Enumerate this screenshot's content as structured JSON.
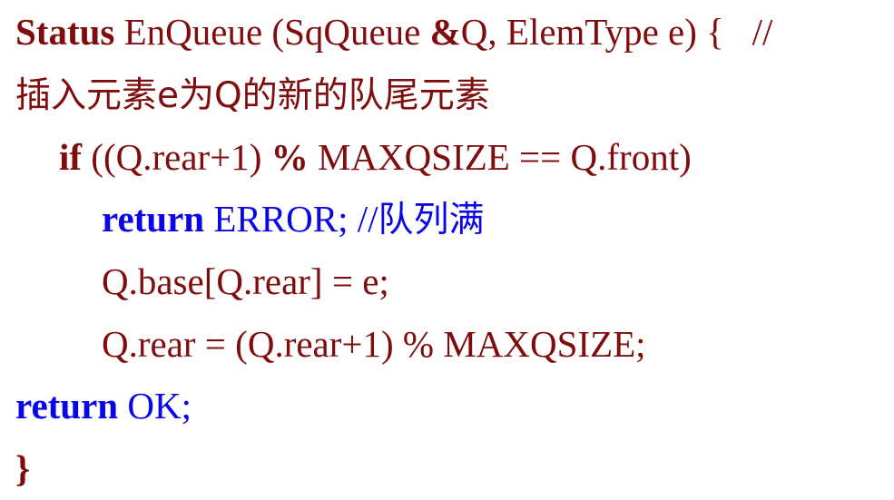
{
  "code": {
    "line1": {
      "keyword": "Status",
      "rest_before_amp": " EnQueue (SqQueue ",
      "amp": "&",
      "rest_after_amp": "Q, ElemType e) {   //"
    },
    "line2": {
      "comment_text": "插入元素e为Q的新的队尾元素"
    },
    "line3": {
      "keyword_if": "if",
      "part1": " ((Q.rear+1) ",
      "percent": "%",
      "part2": " MAXQSIZE == Q.front)"
    },
    "line4": {
      "keyword_return": "return",
      "value": " ERROR; //",
      "comment_text": "队列满"
    },
    "line5": {
      "text": "Q.base[Q.rear] = e;"
    },
    "line6": {
      "text": "Q.rear = (Q.rear+1) % MAXQSIZE;"
    },
    "line7": {
      "keyword_return": "return",
      "value": " OK;"
    },
    "line8": {
      "brace": "}"
    }
  },
  "colors": {
    "code_text": "#7f0d0d",
    "keyword_blue": "#0b06e6",
    "background": "#ffffff"
  }
}
